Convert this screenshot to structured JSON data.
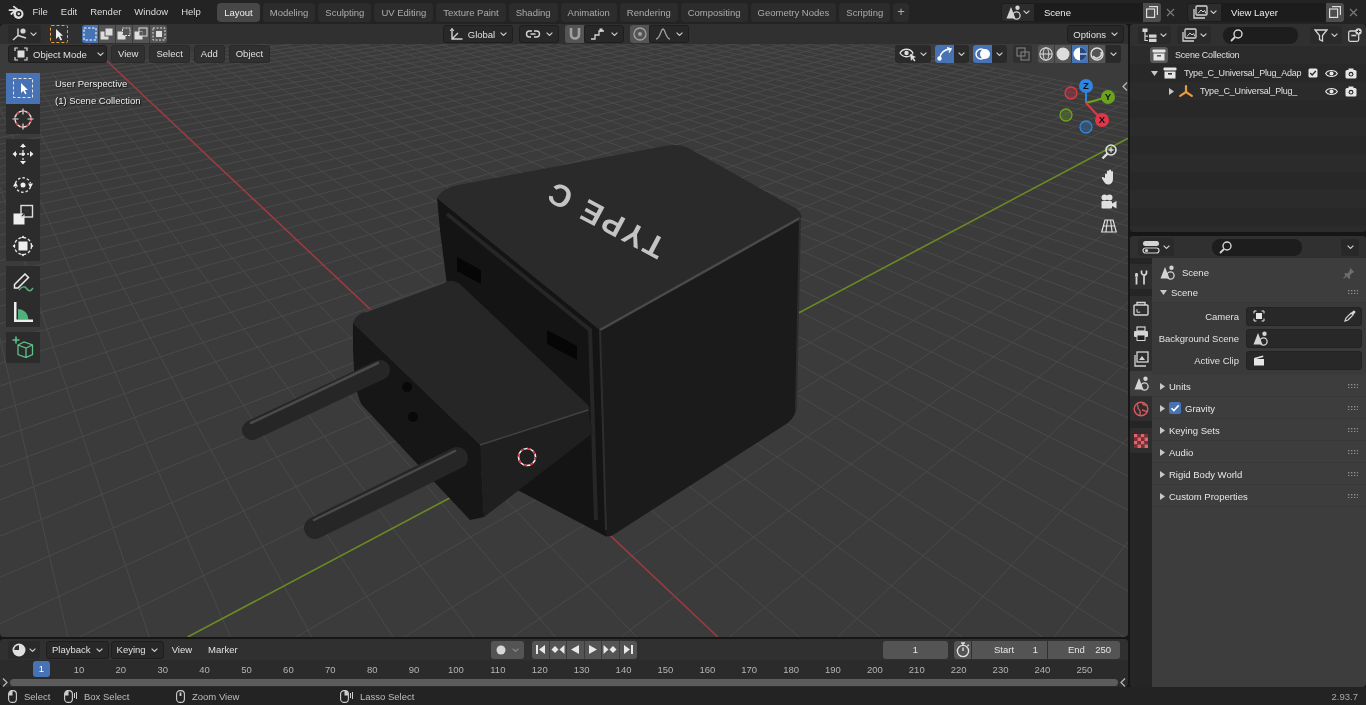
{
  "top_bar": {
    "menus": [
      "File",
      "Edit",
      "Render",
      "Window",
      "Help"
    ],
    "workspaces": [
      {
        "label": "Layout",
        "selected": true
      },
      {
        "label": "Modeling",
        "selected": false
      },
      {
        "label": "Sculpting",
        "selected": false
      },
      {
        "label": "UV Editing",
        "selected": false
      },
      {
        "label": "Texture Paint",
        "selected": false
      },
      {
        "label": "Shading",
        "selected": false
      },
      {
        "label": "Animation",
        "selected": false
      },
      {
        "label": "Rendering",
        "selected": false
      },
      {
        "label": "Compositing",
        "selected": false
      },
      {
        "label": "Geometry Nodes",
        "selected": false
      },
      {
        "label": "Scripting",
        "selected": false
      }
    ],
    "add_workspace": "+",
    "scene": "Scene",
    "view_layer": "View Layer"
  },
  "tool_header": {
    "select_modes": [
      {
        "kind": "set",
        "selected": true
      },
      {
        "kind": "extend",
        "selected": false
      },
      {
        "kind": "subtract",
        "selected": false
      },
      {
        "kind": "difference",
        "selected": false
      },
      {
        "kind": "intersect",
        "selected": false
      }
    ],
    "orientation": "Global",
    "options": "Options"
  },
  "viewport": {
    "mode": "Object Mode",
    "menus": [
      "View",
      "Select",
      "Add",
      "Object"
    ],
    "toggles": [
      {
        "kind": "gizmos",
        "on": true
      },
      {
        "kind": "overlays",
        "on": true
      },
      {
        "kind": "xray",
        "on": false
      }
    ],
    "shading": [
      {
        "kind": "wireframe",
        "selected": false
      },
      {
        "kind": "solid",
        "selected": false
      },
      {
        "kind": "material",
        "selected": true
      },
      {
        "kind": "rendered",
        "selected": false
      }
    ],
    "info": [
      "User Perspective",
      "(1) Scene Collection"
    ],
    "tools": [
      {
        "kind": "select-box",
        "selected": true
      },
      {
        "kind": "cursor",
        "selected": false
      },
      {
        "kind": "move",
        "selected": false
      },
      {
        "kind": "rotate",
        "selected": false
      },
      {
        "kind": "scale",
        "selected": false
      },
      {
        "kind": "transform",
        "selected": false
      },
      {
        "kind": "annotate",
        "selected": false
      },
      {
        "kind": "measure",
        "selected": false
      },
      {
        "kind": "add-cube",
        "selected": false
      }
    ],
    "gizmo_axes": [
      {
        "label": "Z",
        "color": "#2f85e0"
      },
      {
        "label": "Y",
        "color": "#6ba31f"
      },
      {
        "label": "X",
        "color": "#e0364a"
      }
    ],
    "model_label": "TYPE C"
  },
  "timeline": {
    "menus": [
      {
        "label": "Playback",
        "kind": "dropdown"
      },
      {
        "label": "Keying",
        "kind": "dropdown"
      },
      {
        "label": "View",
        "kind": "menu"
      },
      {
        "label": "Marker",
        "kind": "menu"
      }
    ],
    "current_frame": "1",
    "start_label": "Start",
    "start": "1",
    "end_label": "End",
    "end": "250",
    "playhead": "1",
    "ruler": [
      "10",
      "20",
      "30",
      "40",
      "50",
      "60",
      "70",
      "80",
      "90",
      "100",
      "110",
      "120",
      "130",
      "140",
      "150",
      "160",
      "170",
      "180",
      "190",
      "200",
      "210",
      "220",
      "230",
      "240",
      "250"
    ]
  },
  "status_bar": {
    "hints": [
      {
        "kind": "left-click",
        "label": "Select"
      },
      {
        "kind": "left-drag",
        "label": "Box Select"
      },
      {
        "kind": "middle-drag",
        "label": "Zoom View"
      },
      {
        "kind": "right-drag",
        "label": "Lasso Select"
      }
    ],
    "version": "2.93.7"
  },
  "outliner": {
    "tree": [
      {
        "label": "Scene Collection",
        "kind": "scene",
        "children": [
          {
            "label": "Type_C_Universal_Plug_Adap",
            "kind": "collection",
            "expanded": true,
            "checked": true,
            "children": [
              {
                "label": "Type_C_Universal_Plug_",
                "kind": "object",
                "expanded": false
              }
            ]
          }
        ]
      }
    ]
  },
  "properties": {
    "tabs": [
      {
        "kind": "tool",
        "selected": false
      },
      {
        "kind": "render",
        "selected": false
      },
      {
        "kind": "output",
        "selected": false
      },
      {
        "kind": "view-layer",
        "selected": false
      },
      {
        "kind": "scene",
        "selected": true
      },
      {
        "kind": "world",
        "selected": false
      },
      {
        "kind": "texture",
        "selected": false
      }
    ],
    "context": "Scene",
    "panels": [
      {
        "label": "Scene",
        "expanded": true,
        "fields": [
          {
            "label": "Camera",
            "kind": "camera"
          },
          {
            "label": "Background Scene",
            "kind": "scene"
          },
          {
            "label": "Active Clip",
            "kind": "clip"
          }
        ]
      },
      {
        "label": "Units",
        "expanded": false
      },
      {
        "label": "Gravity",
        "expanded": false,
        "toggle": {
          "checked": true
        }
      },
      {
        "label": "Keying Sets",
        "expanded": false
      },
      {
        "label": "Audio",
        "expanded": false
      },
      {
        "label": "Rigid Body World",
        "expanded": false
      },
      {
        "label": "Custom Properties",
        "expanded": false
      }
    ]
  }
}
